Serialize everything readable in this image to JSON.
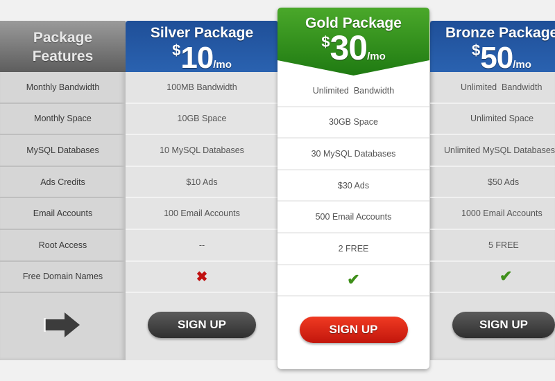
{
  "features": {
    "header": [
      "Package",
      "Features"
    ],
    "rows": [
      "Monthly Bandwidth",
      "Monthly Space",
      "MySQL Databases",
      "Ads Credits",
      "Email Accounts",
      "Root Access",
      "Free Domain Names"
    ],
    "footer_icon": "arrow-right-icon"
  },
  "plans": [
    {
      "name": "Silver Package",
      "currency": "$",
      "amount": "10",
      "period": "/mo",
      "header_color": "#2457a3",
      "values": [
        "100MB Bandwidth",
        "10GB Space",
        "10 MySQL Databases",
        "$10 Ads",
        "100 Email Accounts",
        "--"
      ],
      "free_domain": "cross-icon",
      "button": "SIGN UP"
    },
    {
      "name": "Gold Package",
      "currency": "$",
      "amount": "30",
      "period": "/mo",
      "header_color": "#3a9a1e",
      "featured": true,
      "values": [
        "Unlimited  Bandwidth",
        "30GB Space",
        "30 MySQL Databases",
        "$30 Ads",
        "500 Email Accounts",
        "2 FREE"
      ],
      "free_domain": "check-icon",
      "button": "SIGN UP"
    },
    {
      "name": "Bronze Package",
      "currency": "$",
      "amount": "50",
      "period": "/mo",
      "header_color": "#2457a3",
      "values": [
        "Unlimited  Bandwidth",
        "Unlimited Space",
        "Unlimited MySQL Databases",
        "$50 Ads",
        "1000 Email Accounts",
        "5 FREE"
      ],
      "free_domain": "check-icon",
      "button": "SIGN UP"
    }
  ],
  "icons": {
    "cross": "✖",
    "check": "✔"
  }
}
